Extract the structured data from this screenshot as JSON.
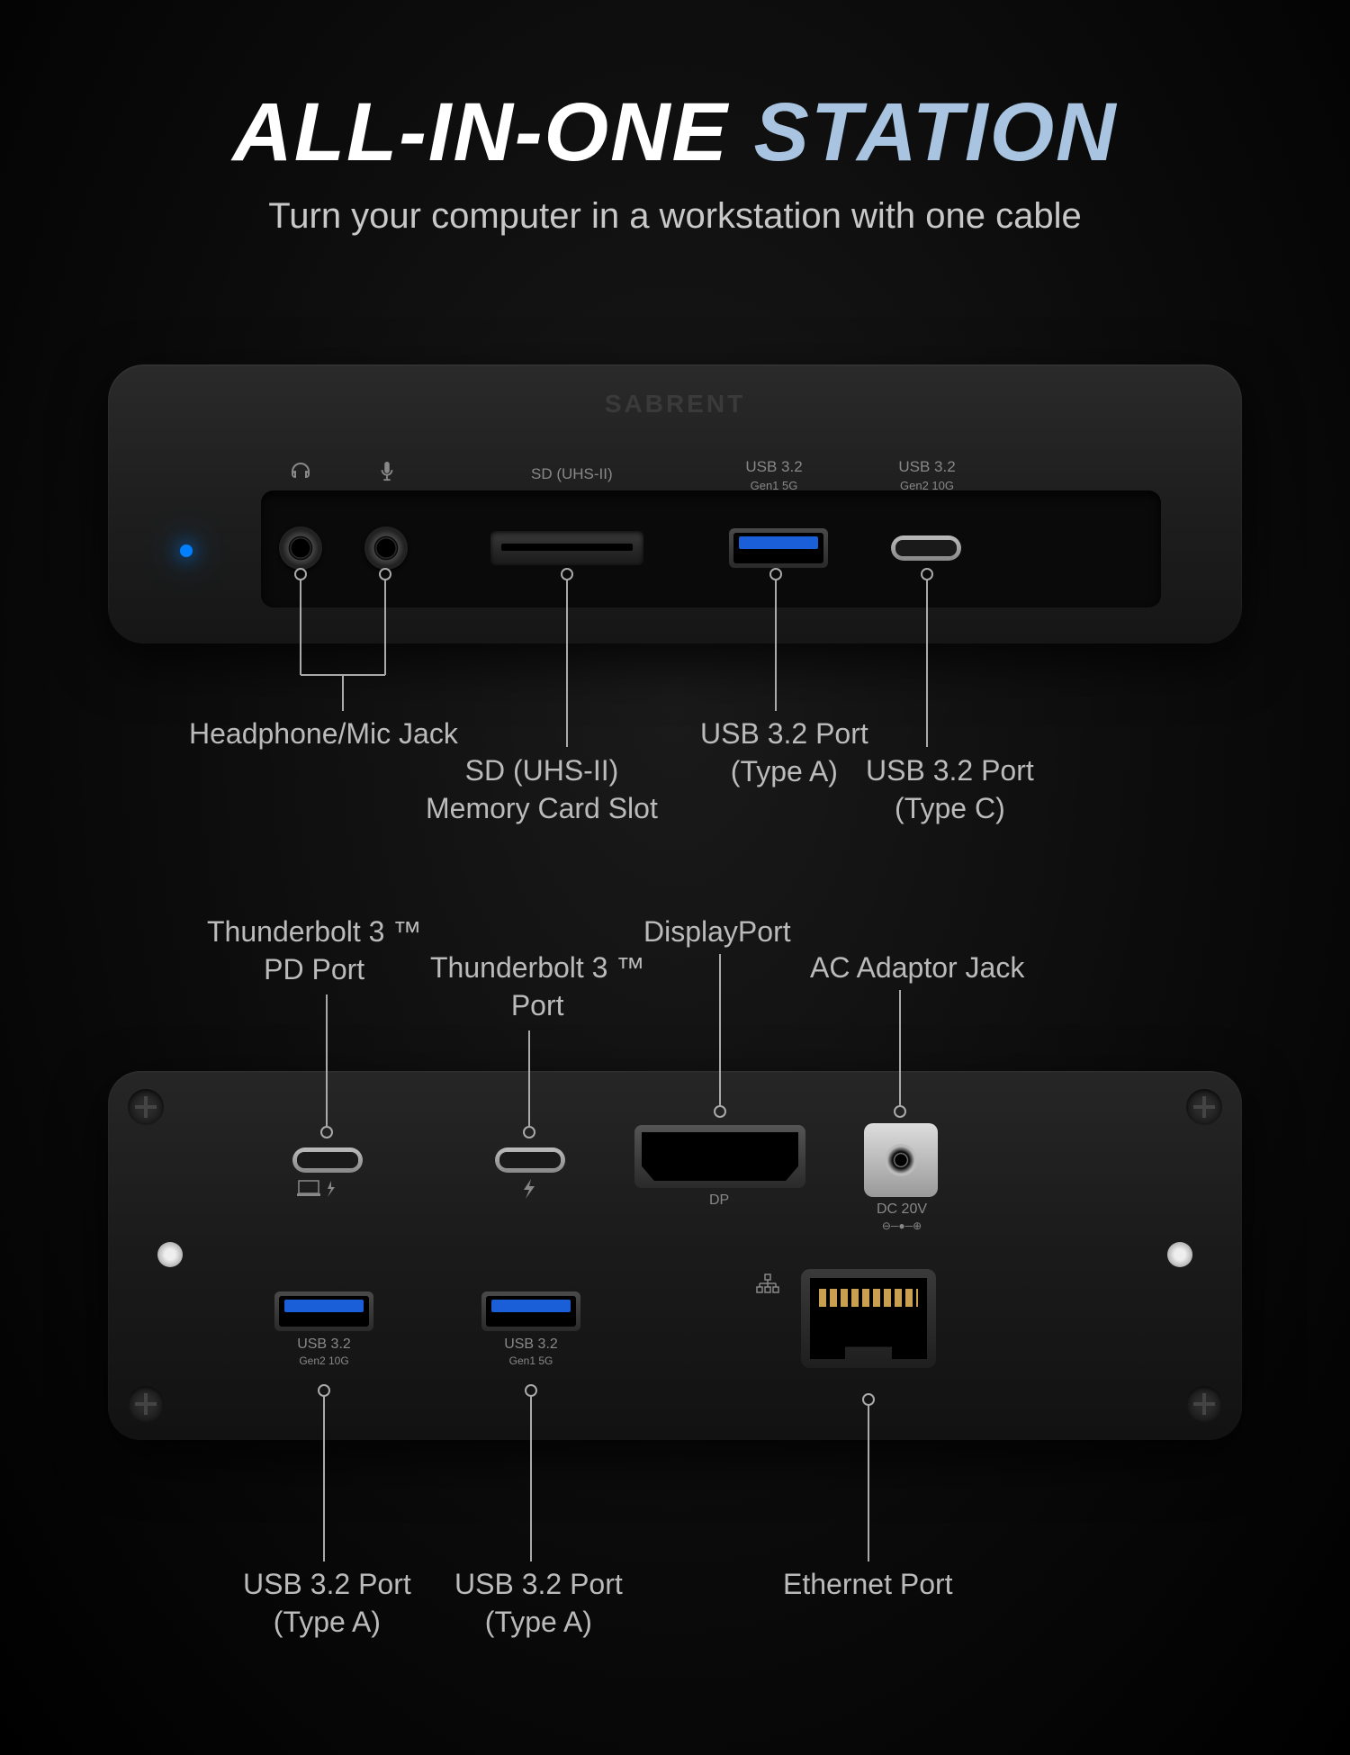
{
  "title": {
    "part1": "ALL-IN-ONE",
    "part2": "STATION"
  },
  "subtitle": "Turn your computer in a workstation with one cable",
  "brand": "SABRENT",
  "front": {
    "icons": {
      "headphone": "headphone-icon",
      "mic": "mic-icon"
    },
    "labels": {
      "sd": "SD (UHS-II)",
      "usb_a_top": "USB 3.2",
      "usb_a_sub": "Gen1 5G",
      "usb_c_top": "USB 3.2",
      "usb_c_sub": "Gen2 10G"
    },
    "callouts": {
      "audio": "Headphone/Mic Jack",
      "sd_line1": "SD (UHS-II)",
      "sd_line2": "Memory Card Slot",
      "usb_a_line1": "USB 3.2 Port",
      "usb_a_line2": "(Type A)",
      "usb_c_line1": "USB 3.2 Port",
      "usb_c_line2": "(Type C)"
    }
  },
  "back": {
    "labels": {
      "dp": "DP",
      "dc_line1": "DC 20V",
      "usb1_top": "USB 3.2",
      "usb1_sub": "Gen2 10G",
      "usb2_top": "USB 3.2",
      "usb2_sub": "Gen1 5G"
    },
    "callouts": {
      "tb_pd_line1": "Thunderbolt 3 ™",
      "tb_pd_line2": "PD Port",
      "tb_line1": "Thunderbolt 3 ™",
      "tb_line2": "Port",
      "dp": "DisplayPort",
      "ac": "AC Adaptor Jack",
      "usb_a1_line1": "USB 3.2 Port",
      "usb_a1_line2": "(Type A)",
      "usb_a2_line1": "USB 3.2 Port",
      "usb_a2_line2": "(Type A)",
      "eth": "Ethernet Port"
    }
  }
}
